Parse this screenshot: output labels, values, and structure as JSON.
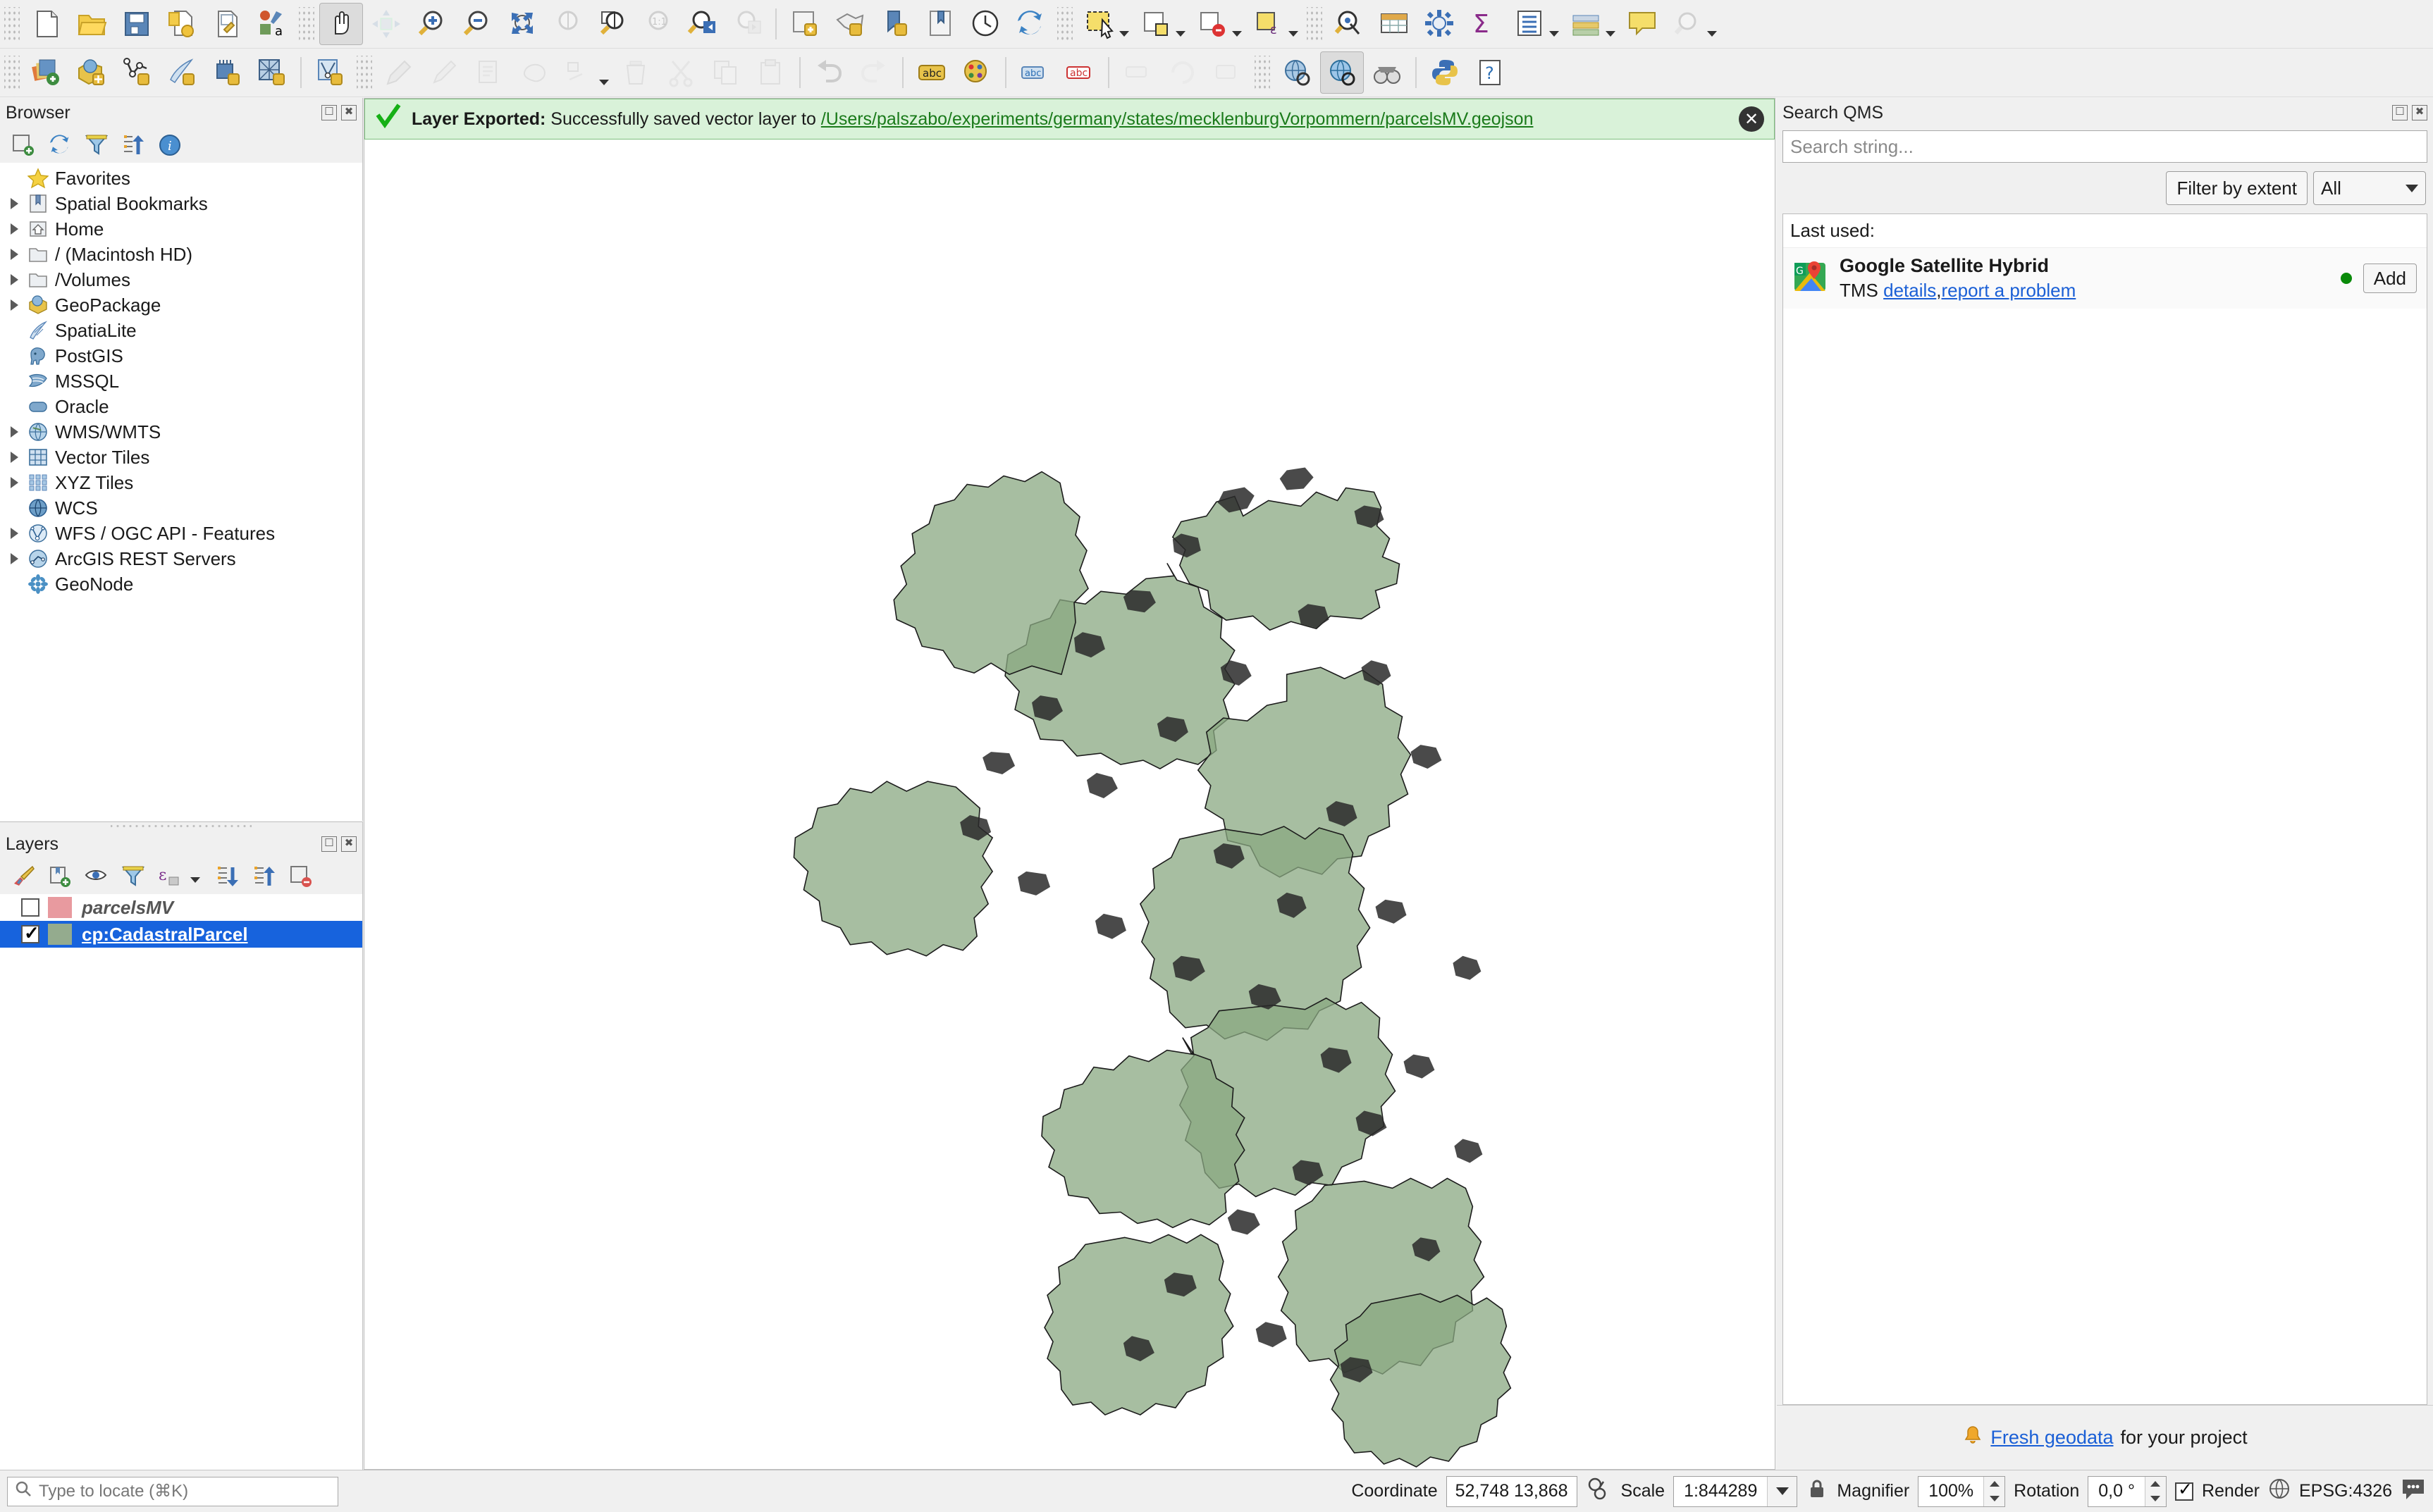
{
  "toolbars": {
    "row1": [
      {
        "name": "new-project-button",
        "icon": "document-icon"
      },
      {
        "name": "open-project-button",
        "icon": "folder-open-icon"
      },
      {
        "name": "save-project-button",
        "icon": "floppy-save-icon"
      },
      {
        "name": "save-project-as-button",
        "icon": "save-as-icon"
      },
      {
        "name": "new-print-layout-button",
        "icon": "layout-wrench-icon"
      },
      {
        "name": "style-manager-button",
        "icon": "style-manager-icon"
      },
      {
        "name": "pan-map-button",
        "icon": "hand-pan-icon"
      },
      {
        "name": "pan-to-selection-button",
        "icon": "pan-selection-icon"
      },
      {
        "name": "zoom-in-button",
        "icon": "zoom-in-icon"
      },
      {
        "name": "zoom-out-button",
        "icon": "zoom-out-icon"
      },
      {
        "name": "zoom-full-button",
        "icon": "zoom-full-icon"
      },
      {
        "name": "zoom-to-selection-button",
        "icon": "zoom-selection-icon"
      },
      {
        "name": "zoom-to-layer-button",
        "icon": "zoom-layer-icon"
      },
      {
        "name": "zoom-native-button",
        "icon": "zoom-native-icon"
      },
      {
        "name": "zoom-last-button",
        "icon": "zoom-last-icon"
      },
      {
        "name": "zoom-next-button",
        "icon": "zoom-next-icon"
      },
      {
        "name": "new-map-view-button",
        "icon": "map-view-icon"
      },
      {
        "name": "new-3d-map-view-button",
        "icon": "map-3d-icon"
      },
      {
        "name": "show-bookmarks-button",
        "icon": "bookmark-gear-icon"
      },
      {
        "name": "new-bookmark-button",
        "icon": "bookmark-icon"
      },
      {
        "name": "temporal-controller-button",
        "icon": "clock-icon"
      },
      {
        "name": "refresh-button",
        "icon": "refresh-icon"
      },
      {
        "name": "select-features-button",
        "icon": "select-rect-icon"
      },
      {
        "name": "select-by-value-button",
        "icon": "select-value-icon"
      },
      {
        "name": "deselect-button",
        "icon": "deselect-icon"
      },
      {
        "name": "select-by-expression-button",
        "icon": "select-expression-icon"
      },
      {
        "name": "identify-features-button",
        "icon": "identify-icon"
      },
      {
        "name": "open-attribute-table-button",
        "icon": "attribute-table-icon"
      },
      {
        "name": "processing-toolbox-button",
        "icon": "gear-blue-icon"
      },
      {
        "name": "statistical-summary-button",
        "icon": "sigma-icon"
      },
      {
        "name": "open-field-calculator-button",
        "icon": "table-icon"
      },
      {
        "name": "data-source-manager-button",
        "icon": "layers-dropdown-icon"
      },
      {
        "name": "show-map-tips-button",
        "icon": "map-tip-icon"
      },
      {
        "name": "measure-button",
        "icon": "measure-icon"
      }
    ],
    "row2": [
      {
        "name": "add-vector-layer-button",
        "icon": "add-layer-icon"
      },
      {
        "name": "add-raster-layer-button",
        "icon": "geopackage-icon"
      },
      {
        "name": "add-mesh-layer-button",
        "icon": "vector-star-icon"
      },
      {
        "name": "add-spatialite-layer-button",
        "icon": "feather-star-icon"
      },
      {
        "name": "add-delimited-text-layer-button",
        "icon": "chip-star-icon"
      },
      {
        "name": "add-wms-layer-button",
        "icon": "grid-star-icon"
      },
      {
        "name": "add-wfs-layer-button",
        "icon": "wfs-star-icon"
      },
      {
        "name": "toggle-editing-button",
        "icon": "pencil-icon"
      },
      {
        "name": "save-layer-edits-button",
        "icon": "save-edits-icon"
      },
      {
        "name": "add-feature-button",
        "icon": "add-feature-icon"
      },
      {
        "name": "vertex-tool-button",
        "icon": "vertex-tool-icon"
      },
      {
        "name": "modify-attributes-button",
        "icon": "modify-attributes-icon"
      },
      {
        "name": "delete-selected-button",
        "icon": "trash-icon"
      },
      {
        "name": "cut-features-button",
        "icon": "scissors-icon"
      },
      {
        "name": "copy-features-button",
        "icon": "copy-icon"
      },
      {
        "name": "paste-features-button",
        "icon": "paste-icon"
      },
      {
        "name": "undo-button",
        "icon": "undo-arrow-icon"
      },
      {
        "name": "redo-button",
        "icon": "redo-arrow-icon"
      },
      {
        "name": "label-layer-button",
        "icon": "abc-label-icon"
      },
      {
        "name": "style-layer-button",
        "icon": "palette-icon"
      },
      {
        "name": "pin-labels-button",
        "icon": "pin-label-icon"
      },
      {
        "name": "show-hide-labels-button",
        "icon": "abc-red-icon"
      },
      {
        "name": "move-label-button",
        "icon": "move-label-icon"
      },
      {
        "name": "rotate-label-button",
        "icon": "rotate-label-icon"
      },
      {
        "name": "change-label-button",
        "icon": "change-label-icon"
      },
      {
        "name": "metasearch-button",
        "icon": "globe-search-icon"
      },
      {
        "name": "qms-search-button",
        "icon": "globe-qms-icon"
      },
      {
        "name": "georeferencer-button",
        "icon": "georeferencer-icon"
      },
      {
        "name": "python-console-button",
        "icon": "python-icon"
      },
      {
        "name": "help-button",
        "icon": "help-icon"
      }
    ]
  },
  "browser": {
    "title": "Browser",
    "toolbar": [
      {
        "name": "add-selected-layers-button",
        "icon": "add-layer-small-icon"
      },
      {
        "name": "refresh-browser-button",
        "icon": "refresh-icon"
      },
      {
        "name": "filter-browser-button",
        "icon": "filter-icon"
      },
      {
        "name": "collapse-all-button",
        "icon": "collapse-all-icon"
      },
      {
        "name": "properties-widget-button",
        "icon": "info-icon"
      }
    ],
    "items": [
      {
        "label": "Favorites",
        "icon": "star-icon",
        "expandable": false
      },
      {
        "label": "Spatial Bookmarks",
        "icon": "bookmark-icon",
        "expandable": true
      },
      {
        "label": "Home",
        "icon": "home-icon",
        "expandable": true
      },
      {
        "label": "/ (Macintosh HD)",
        "icon": "folder-icon",
        "expandable": true
      },
      {
        "label": "/Volumes",
        "icon": "folder-icon",
        "expandable": true
      },
      {
        "label": "GeoPackage",
        "icon": "geopackage-icon",
        "expandable": true
      },
      {
        "label": "SpatiaLite",
        "icon": "feather-icon",
        "expandable": false
      },
      {
        "label": "PostGIS",
        "icon": "elephant-icon",
        "expandable": false
      },
      {
        "label": "MSSQL",
        "icon": "mssql-icon",
        "expandable": false
      },
      {
        "label": "Oracle",
        "icon": "oracle-icon",
        "expandable": false
      },
      {
        "label": "WMS/WMTS",
        "icon": "globe-wms-icon",
        "expandable": true
      },
      {
        "label": "Vector Tiles",
        "icon": "vector-tiles-icon",
        "expandable": true
      },
      {
        "label": "XYZ Tiles",
        "icon": "xyz-tiles-icon",
        "expandable": true
      },
      {
        "label": "WCS",
        "icon": "globe-wcs-icon",
        "expandable": false
      },
      {
        "label": "WFS / OGC API - Features",
        "icon": "wfs-icon",
        "expandable": true
      },
      {
        "label": "ArcGIS REST Servers",
        "icon": "arcgis-rest-icon",
        "expandable": true
      },
      {
        "label": "GeoNode",
        "icon": "geonode-icon",
        "expandable": false
      }
    ]
  },
  "layers": {
    "title": "Layers",
    "toolbar": [
      {
        "name": "open-layer-styling-button",
        "icon": "paintbrush-icon"
      },
      {
        "name": "add-group-button",
        "icon": "add-group-icon"
      },
      {
        "name": "manage-layer-visibility-button",
        "icon": "eye-icon"
      },
      {
        "name": "filter-legend-button",
        "icon": "filter-icon"
      },
      {
        "name": "filter-legend-expression-button",
        "icon": "epsilon-icon"
      },
      {
        "name": "expand-all-button",
        "icon": "expand-all-icon"
      },
      {
        "name": "collapse-all-button",
        "icon": "collapse-all-icon"
      },
      {
        "name": "remove-layer-button",
        "icon": "remove-layer-icon"
      }
    ],
    "items": [
      {
        "name": "parcelsMV",
        "checked": false,
        "color": "#e89a9f",
        "selected": false
      },
      {
        "name": "cp:CadastralParcel",
        "checked": true,
        "color": "#94ab8e",
        "selected": true
      }
    ]
  },
  "message_bar": {
    "icon": "green-check-icon",
    "title": "Layer Exported:",
    "text": "Successfully saved vector layer to",
    "link": "/Users/palszabo/experiments/germany/states/mecklenburgVorpommern/parcelsMV.geojson",
    "close_label": "✕",
    "background": "#d9f2d9",
    "border": "#7ebf7e"
  },
  "qms": {
    "title": "Search QMS",
    "search_placeholder": "Search string...",
    "filter_by_extent_label": "Filter by extent",
    "type_filter_value": "All",
    "last_used_label": "Last used:",
    "result": {
      "title": "Google Satellite Hybrid",
      "type": "TMS",
      "details_link": "details",
      "separator": ",",
      "report_link": "report a problem",
      "status_color": "#0a8a0a",
      "add_label": "Add"
    },
    "footer_icon": "bell-icon",
    "footer_link": "Fresh geodata",
    "footer_text": "for your project"
  },
  "statusbar": {
    "locator_placeholder": "Type to locate (⌘K)",
    "coordinate_label": "Coordinate",
    "coordinate_value": "52,748 13,868",
    "scale_label": "Scale",
    "scale_value": "1:844289",
    "magnifier_label": "Magnifier",
    "magnifier_value": "100%",
    "rotation_label": "Rotation",
    "rotation_value": "0,0 °",
    "render_label": "Render",
    "crs_value": "EPSG:4326",
    "messages_icon": "speech-bubble-icon"
  },
  "map": {
    "background": "#ffffff",
    "parcel_fill": "#8aa882",
    "parcel_stroke": "#1b1b1b"
  }
}
